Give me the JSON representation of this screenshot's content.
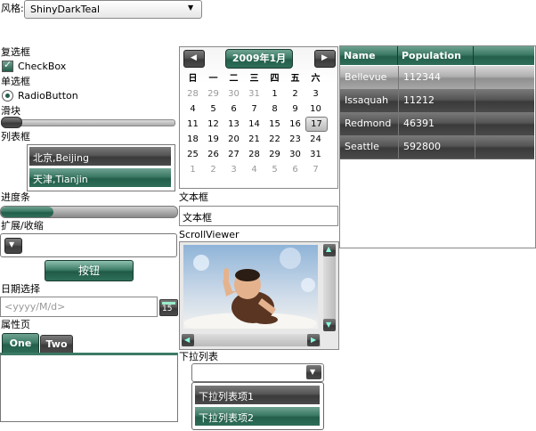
{
  "style_label": "风格:",
  "style_select": "ShinyDarkTeal",
  "checkbox_section": "复选框",
  "checkbox_label": "CheckBox",
  "radio_section": "单选框",
  "radio_label": "RadioButton",
  "slider_section": "滑块",
  "slider_value": 0.1,
  "listbox_section": "列表框",
  "listbox_items": [
    "北京,Beijing",
    "天津,Tianjin"
  ],
  "progress_section": "进度条",
  "progress_value": 0.3,
  "expander_section": "扩展/收缩",
  "button_label": "按钮",
  "datepicker_section": "日期选择",
  "datepicker_placeholder": "<yyyy/M/d>",
  "datepicker_button": "15",
  "tabs_section": "属性页",
  "tabs": [
    "One",
    "Two"
  ],
  "calendar": {
    "title": "2009年1月",
    "weekdays": [
      "日",
      "一",
      "二",
      "三",
      "四",
      "五",
      "六"
    ],
    "weeks": [
      [
        "28",
        "29",
        "30",
        "31",
        "1",
        "2",
        "3"
      ],
      [
        "4",
        "5",
        "6",
        "7",
        "8",
        "9",
        "10"
      ],
      [
        "11",
        "12",
        "13",
        "14",
        "15",
        "16",
        "17"
      ],
      [
        "18",
        "19",
        "20",
        "21",
        "22",
        "23",
        "24"
      ],
      [
        "25",
        "26",
        "27",
        "28",
        "29",
        "30",
        "31"
      ],
      [
        "1",
        "2",
        "3",
        "4",
        "5",
        "6",
        "7"
      ]
    ],
    "selected": "17"
  },
  "textbox_section": "文本框",
  "textbox_value": "文本框",
  "scrollviewer_section": "ScrollViewer",
  "datagrid": {
    "headers": [
      "Name",
      "Population"
    ],
    "rows": [
      [
        "Bellevue",
        "112344"
      ],
      [
        "Issaquah",
        "11212"
      ],
      [
        "Redmond",
        "46391"
      ],
      [
        "Seattle",
        "592800"
      ]
    ]
  },
  "combobox_section": "下拉列表",
  "combobox_items": [
    "下拉列表项1",
    "下拉列表项2"
  ]
}
